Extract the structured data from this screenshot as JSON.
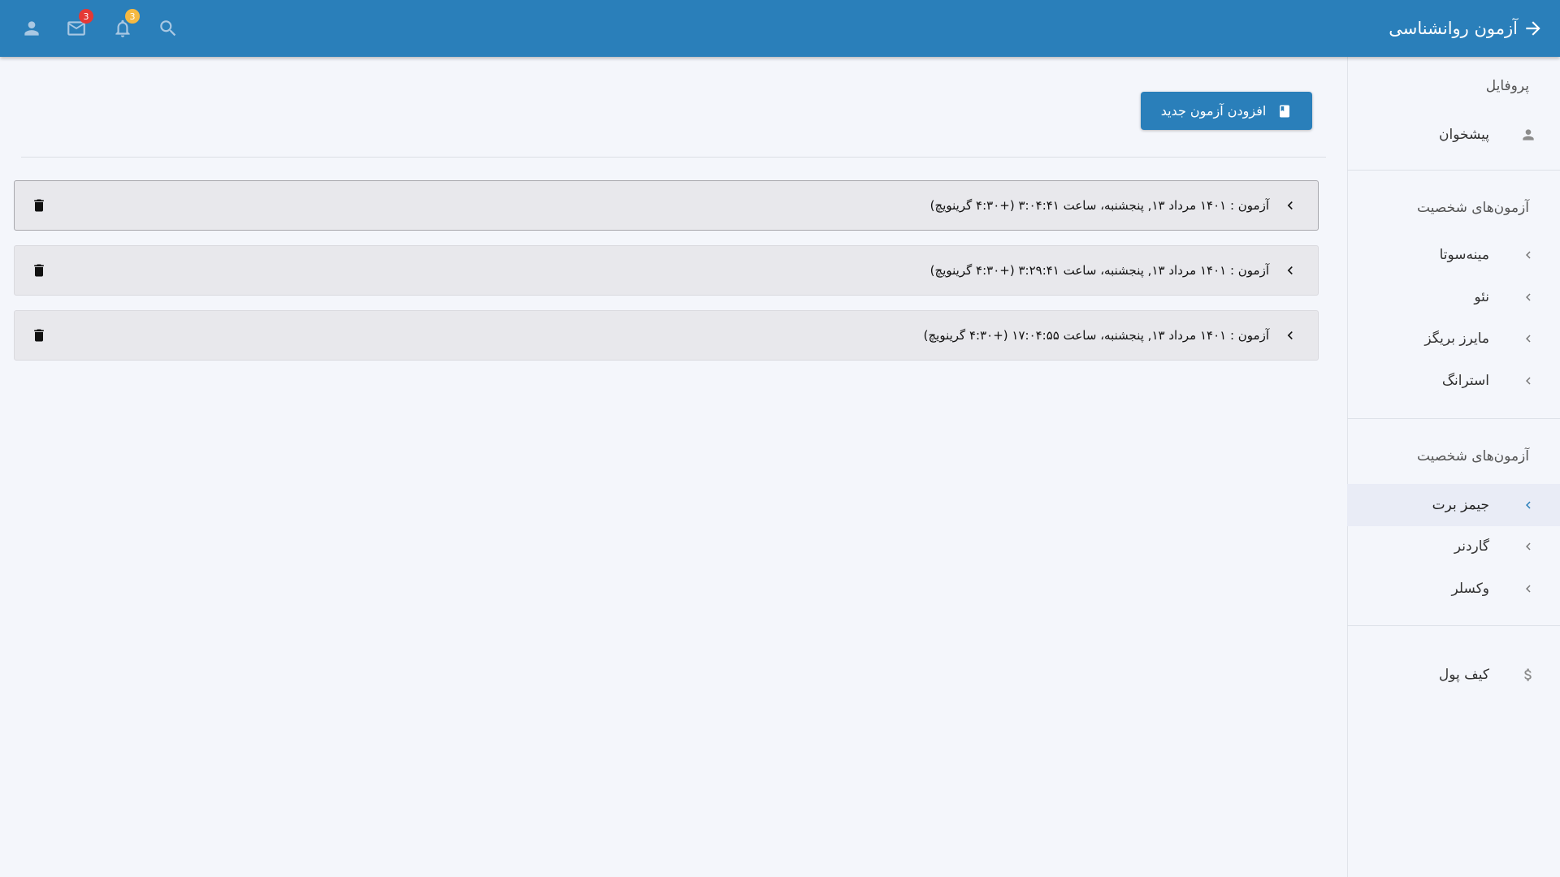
{
  "header": {
    "title": "آزمون روانشناسی",
    "icons": {
      "back": "arrow-back-icon",
      "profile": "account-icon",
      "mail": "mail-icon",
      "notifications": "bell-icon",
      "search": "search-icon"
    },
    "mail_badge": "3",
    "notification_badge": "3",
    "colors": {
      "bar": "#2a7fba",
      "mail_badge": "#e53935",
      "notification_badge": "#f5b942"
    }
  },
  "sidebar": {
    "profile_heading": "پروفایل",
    "dashboard_label": "پیشخوان",
    "section1_heading": "آزمون‌های شخصیت",
    "section1_items": [
      "مینه‌سوتا",
      "نئو",
      "مایرز بریگز",
      "استرانگ"
    ],
    "section2_heading": "آزمون‌های شخصیت",
    "section2_items": [
      "جیمز برت",
      "گاردنر",
      "وکسلر"
    ],
    "active_item": "جیمز برت",
    "wallet_label": "کیف پول"
  },
  "main": {
    "add_button_label": "افزودن آزمون جدید",
    "exams": [
      "آزمون : ۱۴۰۱ مرداد ۱۳, پنجشنبه، ساعت ۳:۰۴:۴۱ (+۴:۳۰ گرینویچ)",
      "آزمون : ۱۴۰۱ مرداد ۱۳, پنجشنبه، ساعت ۳:۲۹:۴۱ (+۴:۳۰ گرینویچ)",
      "آزمون : ۱۴۰۱ مرداد ۱۳, پنجشنبه، ساعت ۱۷:۰۴:۵۵ (+۴:۳۰ گرینویچ)"
    ]
  }
}
